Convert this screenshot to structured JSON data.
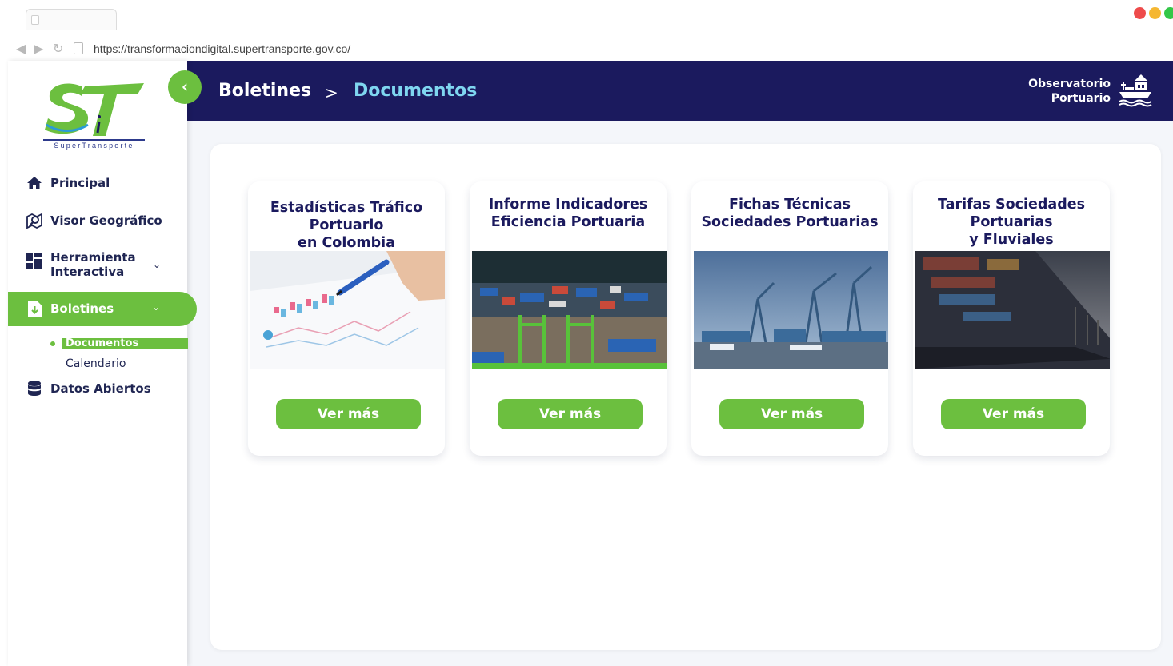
{
  "browser": {
    "url": "https://transformaciondigital.supertransporte.gov.co/",
    "window_dot_colors": [
      "#ee4b4b",
      "#f5b731",
      "#33c748"
    ]
  },
  "logo": {
    "text": "SuperTransporte"
  },
  "sidebar": {
    "items": [
      {
        "label": "Principal",
        "icon": "home-icon"
      },
      {
        "label": "Visor Geográfico",
        "icon": "map-search-icon"
      },
      {
        "label": "Herramienta Interactiva",
        "label_line1": "Herramienta",
        "label_line2": "Interactiva",
        "icon": "dashboard-icon"
      },
      {
        "label": "Boletines",
        "icon": "document-download-icon",
        "active": true
      },
      {
        "label": "Datos Abiertos",
        "icon": "database-icon"
      }
    ],
    "subitems": [
      {
        "label": "Documentos",
        "active": true
      },
      {
        "label": "Calendario"
      }
    ]
  },
  "header": {
    "breadcrumb_parent": "Boletines",
    "breadcrumb_separator": ">",
    "breadcrumb_current": "Documentos",
    "observatorio_line1": "Observatorio",
    "observatorio_line2": "Portuario"
  },
  "cards": [
    {
      "title": "Estadísticas Tráfico Portuario en Colombia",
      "image": "statistics-chart-image",
      "button": "Ver más"
    },
    {
      "title": "Informe Indicadores Eficiencia Portuaria",
      "image": "port-aerial-containers-image",
      "button": "Ver más"
    },
    {
      "title": "Fichas Técnicas Sociedades Portuarias",
      "image": "port-cranes-image",
      "button": "Ver más"
    },
    {
      "title": "Tarifas Sociedades Portuarias y Fluviales",
      "image": "container-ship-image",
      "button": "Ver más"
    }
  ],
  "colors": {
    "brand_navy": "#1b1a5e",
    "brand_green": "#6cbf3f",
    "breadcrumb_accent": "#7fd6f0"
  }
}
